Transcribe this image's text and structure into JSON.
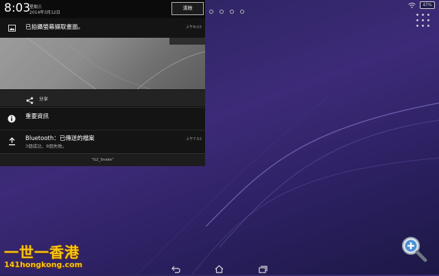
{
  "status_bar": {
    "battery": "47%"
  },
  "shade_header": {
    "time": "8:03",
    "weekday": "星期三",
    "date": "2014年3月12日",
    "clear_label": "清除"
  },
  "notifications": [
    {
      "icon": "image-icon",
      "title": "已拍攝螢幕擷取畫面。",
      "time": "上午8:03",
      "action": "分享"
    },
    {
      "icon": "info-icon",
      "title": "重要資訊"
    },
    {
      "icon": "upload-icon",
      "title": "Bluetooth：已傳送的檔案",
      "subtitle": "3個成功，8個失敗。",
      "time": "上午7:52"
    }
  ],
  "footer_label": "\"G2_Snake\"",
  "watermark": {
    "line1": "一世一香港",
    "line2": "141hongkong.com"
  },
  "colors": {
    "wallpaper": "#3d2a78",
    "shade": "#141414",
    "watermark": "#f5c518"
  }
}
